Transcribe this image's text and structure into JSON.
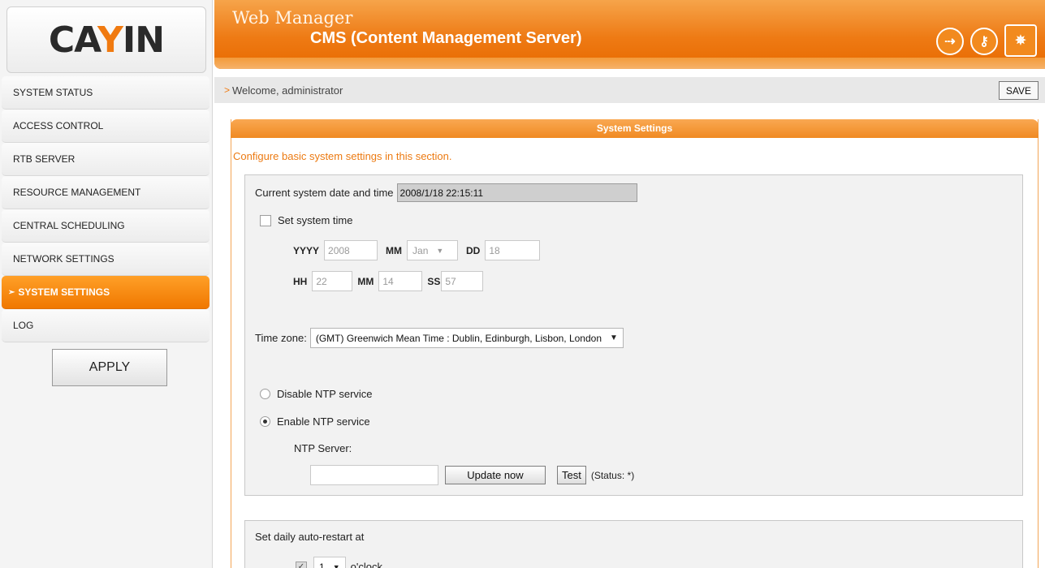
{
  "logo": {
    "text_main": "CA",
    "text_accent": "Y",
    "text_tail": "IN"
  },
  "header": {
    "title": "Web Manager",
    "subtitle": "CMS (Content Management Server)",
    "icons": [
      "logout-icon",
      "key-icon",
      "spark-icon"
    ]
  },
  "sidebar": {
    "items": [
      {
        "label": "SYSTEM STATUS",
        "active": false
      },
      {
        "label": "ACCESS CONTROL",
        "active": false
      },
      {
        "label": "RTB SERVER",
        "active": false
      },
      {
        "label": "RESOURCE MANAGEMENT",
        "active": false
      },
      {
        "label": "CENTRAL SCHEDULING",
        "active": false
      },
      {
        "label": "NETWORK SETTINGS",
        "active": false
      },
      {
        "label": "SYSTEM SETTINGS",
        "active": true
      },
      {
        "label": "LOG",
        "active": false
      }
    ],
    "apply_label": "APPLY"
  },
  "welcome": {
    "marker": ">",
    "text": "Welcome, administrator",
    "save_label": "SAVE"
  },
  "panel": {
    "title": "System Settings",
    "intro": "Configure basic system settings in this section."
  },
  "datetime": {
    "label": "Current system date and time",
    "value": "2008/1/18   22:15:11"
  },
  "set_time": {
    "label": "Set system time",
    "checked": false,
    "yyyy_label": "YYYY",
    "yyyy": "2008",
    "mm_label": "MM",
    "month": "Jan",
    "dd_label": "DD",
    "dd": "18",
    "hh_label": "HH",
    "hh": "22",
    "min_label": "MM",
    "min": "14",
    "ss_label": "SS",
    "ss": "57"
  },
  "timezone": {
    "label": "Time zone:",
    "value": "(GMT) Greenwich Mean Time : Dublin, Edinburgh, Lisbon, London"
  },
  "ntp": {
    "disable_label": "Disable NTP service",
    "enable_label": "Enable NTP service",
    "selected": "enable",
    "server_label": "NTP Server:",
    "server_value": "",
    "update_label": "Update now",
    "test_label": "Test",
    "status": "(Status: *)"
  },
  "restart": {
    "label": "Set daily auto-restart at",
    "hour": "1",
    "suffix": "o'clock"
  },
  "colors": {
    "accent": "#f07a10",
    "panel_border": "#f3a556"
  }
}
